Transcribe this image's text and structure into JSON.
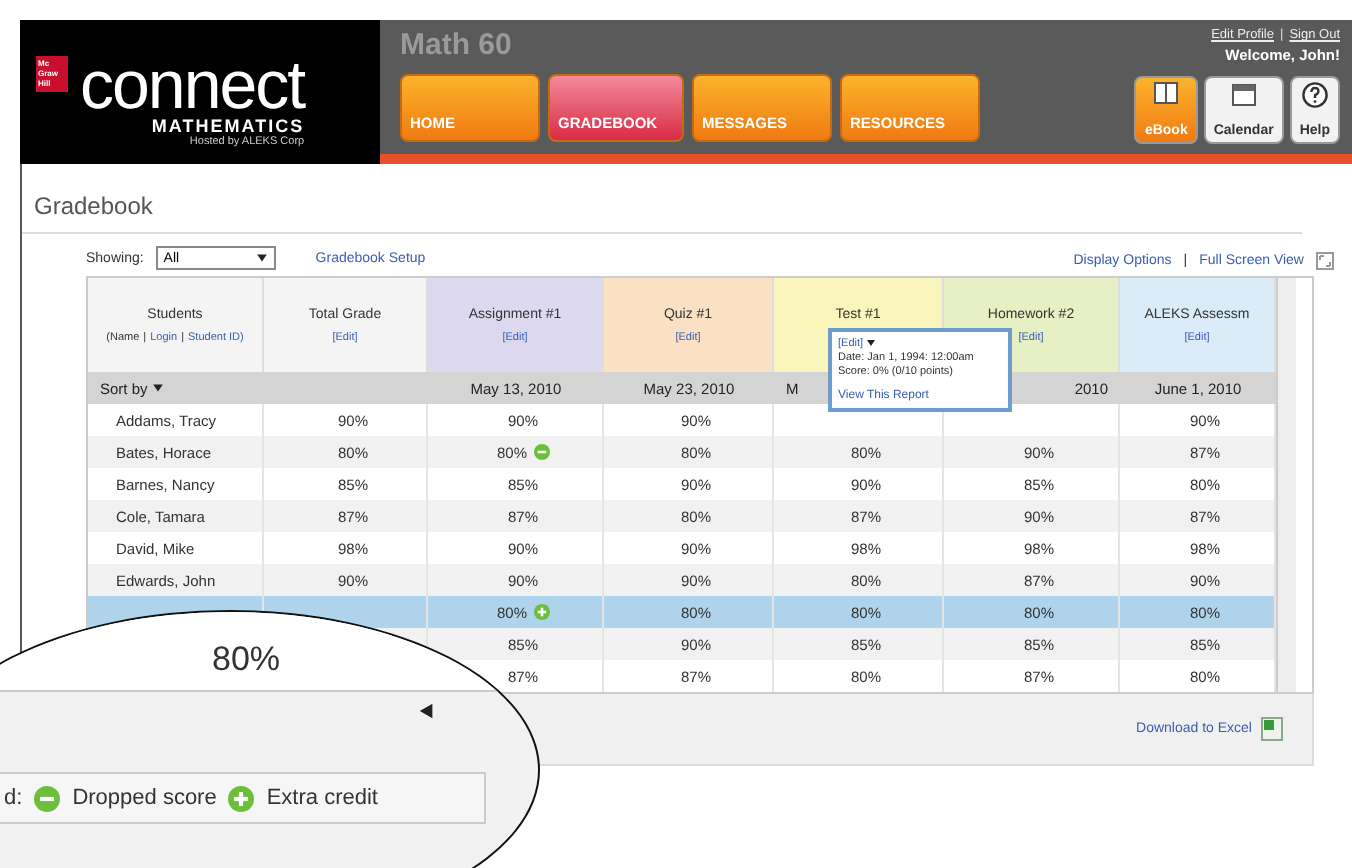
{
  "logo": {
    "publisher": "Mc Graw Hill",
    "product": "connect",
    "subject": "MATHEMATICS",
    "hosted": "Hosted by ALEKS Corp"
  },
  "course": "Math 60",
  "nav": [
    {
      "label": "HOME",
      "selected": false
    },
    {
      "label": "GRADEBOOK",
      "selected": true
    },
    {
      "label": "MESSAGES",
      "selected": false
    },
    {
      "label": "RESOURCES",
      "selected": false
    }
  ],
  "user_links": [
    "Edit Profile",
    "Sign Out"
  ],
  "user_links_separator": "|",
  "welcome": "Welcome, John!",
  "tools": [
    {
      "label": "eBook",
      "kind": "book"
    },
    {
      "label": "Calendar",
      "kind": "calendar"
    },
    {
      "label": "Help",
      "kind": "help"
    }
  ],
  "page_title": "Gradebook",
  "showing": {
    "label": "Showing:",
    "value": "All"
  },
  "setup_link": "Gradebook Setup",
  "view_links": [
    "Display Options",
    "Full Screen View"
  ],
  "view_links_separator": "|",
  "table": {
    "students_header": {
      "title": "Students",
      "prefix": "(Name",
      "separator": "|",
      "links": [
        "Login",
        "Student ID)"
      ]
    },
    "columns": [
      {
        "title": "Total Grade",
        "edit": "[Edit]",
        "color": "#f4f4f4"
      },
      {
        "title": "Assignment #1",
        "edit": "[Edit]",
        "color": "#dcd9ee",
        "date": "May 13, 2010"
      },
      {
        "title": "Quiz #1",
        "edit": "[Edit]",
        "color": "#fbe1c4",
        "date": "May 23, 2010"
      },
      {
        "title": "Test #1",
        "color": "#faf5bb",
        "date": "M"
      },
      {
        "title": "Homework #2",
        "edit": "[Edit]",
        "color": "#e7efc4",
        "date": "2010"
      },
      {
        "title": "ALEKS Assessm",
        "edit": "[Edit]",
        "color": "#d9ecf8",
        "date": "June 1, 2010"
      }
    ],
    "sort_label": "Sort by",
    "rows": [
      {
        "name": "Addams, Tracy",
        "selected": false,
        "cells": [
          "90%",
          "90%",
          "90%",
          null,
          null,
          "90%"
        ]
      },
      {
        "name": "Bates, Horace",
        "selected": false,
        "cells": [
          "80%",
          {
            "text": "80%",
            "kind": "dropped"
          },
          "80%",
          "80%",
          "90%",
          "87%"
        ]
      },
      {
        "name": "Barnes, Nancy",
        "selected": false,
        "cells": [
          "85%",
          "85%",
          "90%",
          "90%",
          "85%",
          "80%"
        ]
      },
      {
        "name": "Cole, Tamara",
        "selected": false,
        "cells": [
          "87%",
          "87%",
          "80%",
          "87%",
          "90%",
          "87%"
        ]
      },
      {
        "name": "David, Mike",
        "selected": false,
        "cells": [
          "98%",
          "90%",
          "90%",
          "98%",
          "98%",
          "98%"
        ]
      },
      {
        "name": "Edwards, John",
        "selected": false,
        "cells": [
          "90%",
          "90%",
          "90%",
          "80%",
          "87%",
          "90%"
        ]
      },
      {
        "name": null,
        "selected": true,
        "cells": [
          null,
          {
            "text": "80%",
            "kind": "extra"
          },
          "80%",
          "80%",
          "80%",
          "80%"
        ]
      },
      {
        "name": null,
        "selected": false,
        "cells": [
          null,
          "85%",
          "90%",
          "85%",
          "85%",
          "85%"
        ]
      },
      {
        "name": null,
        "selected": false,
        "cells": [
          null,
          "87%",
          "87%",
          "80%",
          "87%",
          "80%"
        ]
      }
    ]
  },
  "popup": {
    "edit": "[Edit]",
    "date": "Date: Jan 1, 1994: 12:00am",
    "score": "Score: 0% (0/10 points)",
    "link": "View This Report"
  },
  "download": "Download to Excel",
  "magnifier": {
    "grade": "80%",
    "legend_label": "d:",
    "legend": [
      {
        "kind": "dropped",
        "label": "Dropped score"
      },
      {
        "kind": "extra",
        "label": "Extra credit"
      }
    ]
  }
}
